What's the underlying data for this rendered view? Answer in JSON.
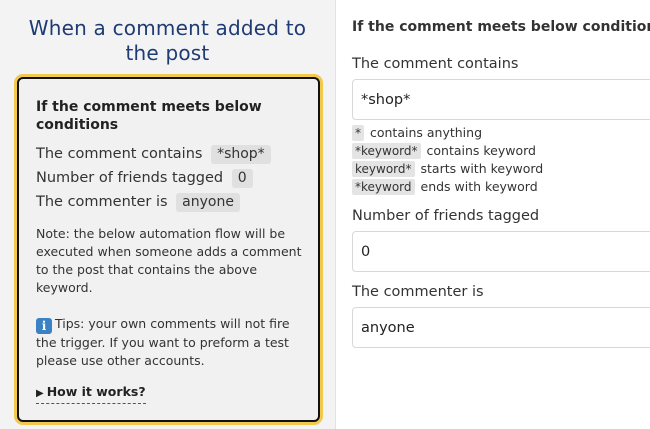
{
  "left": {
    "title": "When a comment added to the post",
    "card": {
      "heading": "If the comment meets below conditions",
      "conditions": [
        {
          "label": "The comment contains",
          "value": "*shop*"
        },
        {
          "label": "Number of friends tagged",
          "value": "0"
        },
        {
          "label": "The commenter is",
          "value": "anyone"
        }
      ],
      "note": "Note: the below automation flow will be executed when someone adds a comment to the post that contains the above keyword.",
      "tip_icon": "info-icon",
      "tip": "Tips: your own comments will not fire the trigger. If you want to preform a test please use other accounts.",
      "how_it_works": "How it works?"
    }
  },
  "right": {
    "heading": "If the comment meets below conditions",
    "comment_contains": {
      "label": "The comment contains",
      "value": "*shop*"
    },
    "legend": [
      {
        "keyword": "*",
        "description": "contains anything"
      },
      {
        "keyword": "*keyword*",
        "description": "contains keyword"
      },
      {
        "keyword": "keyword*",
        "description": "starts with keyword"
      },
      {
        "keyword": "*keyword",
        "description": "ends with keyword"
      }
    ],
    "friends_tagged": {
      "label": "Number of friends tagged",
      "value": "0"
    },
    "commenter": {
      "label": "The commenter is",
      "value": "anyone"
    }
  },
  "colors": {
    "title": "#1f3b73",
    "card_highlight": "#f2c94c",
    "info_icon": "#3b82c4"
  }
}
